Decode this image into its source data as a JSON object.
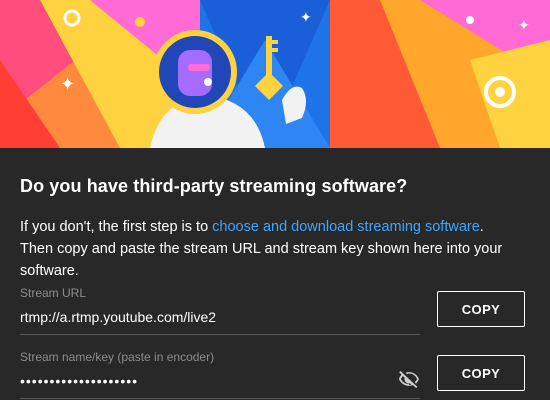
{
  "dialog": {
    "title": "Do you have third-party streaming software?",
    "desc_before": "If you don't, the first step is to ",
    "desc_link": "choose and download streaming software",
    "desc_after": ". Then copy and paste the stream URL and stream key shown here into your software."
  },
  "stream_url": {
    "label": "Stream URL",
    "value": "rtmp://a.rtmp.youtube.com/live2",
    "copy_label": "COPY"
  },
  "stream_key": {
    "label": "Stream name/key (paste in encoder)",
    "value": "••••••••••••••••••••",
    "copy_label": "COPY",
    "visibility_icon": "visibility-off-icon"
  },
  "colors": {
    "background": "#282828",
    "link": "#3ea6ff",
    "hero_blue": "#1565e0",
    "hero_orange": "#ff5a36",
    "hero_pink": "#ff6ad5",
    "hero_yellow": "#ffd23f"
  }
}
